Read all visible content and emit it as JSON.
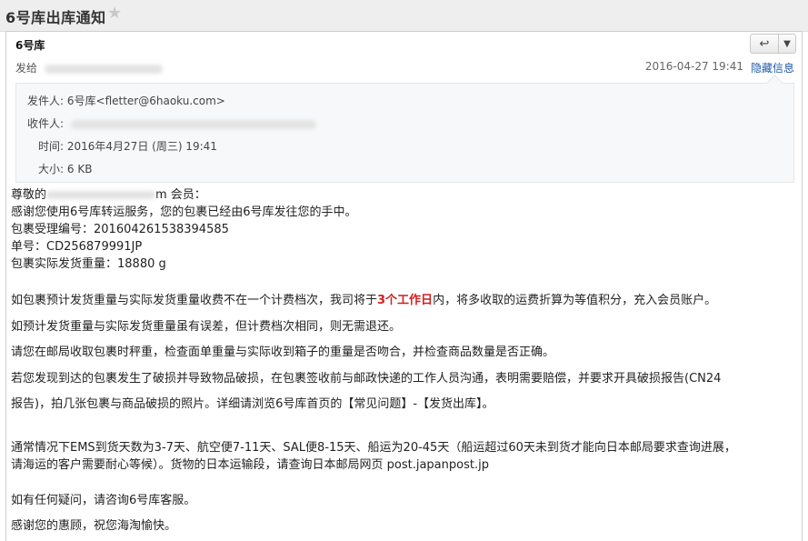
{
  "subject": "6号库出库通知",
  "header": {
    "from_name": "6号库",
    "to_label": "发给",
    "date": "2016-04-27 19:41",
    "hide_details": "隐藏信息"
  },
  "details": {
    "sender_label": "发件人:",
    "sender_value": "6号库<fletter@6haoku.com>",
    "recipient_label": "收件人:",
    "time_label": "时间:",
    "time_value": "2016年4月27日 (周三) 19:41",
    "size_label": "大小:",
    "size_value": "6 KB"
  },
  "body": {
    "greet_prefix": "尊敬的",
    "greet_suffix": "m 会员：",
    "l1": "感谢您使用6号库转运服务，您的包裹已经由6号库发往您的手中。",
    "l2": "包裹受理编号：201604261538394585",
    "l3": "单号：CD256879991JP",
    "l4": "包裹实际发货重量：18880 g",
    "p1_a": "如包裹预计发货重量与实际发货重量收费不在一个计费档次，我司将于",
    "p1_hl": "3个工作日",
    "p1_b": "内，将多收取的运费折算为等值积分，充入会员账户。",
    "p2": "如预计发货重量与实际发货重量虽有误差，但计费档次相同，则无需退还。",
    "p3": "请您在邮局收取包裹时秤重，检查面单重量与实际收到箱子的重量是否吻合，并检查商品数量是否正确。",
    "p4_1": "若您发现到达的包裹发生了破损并导致物品破损，在包裹签收前与邮政快递的工作人员沟通，表明需要赔偿，并要求开具破损报告(CN24",
    "p4_2": "报告)，拍几张包裹与商品破损的照片。详细请浏览6号库首页的【常见问题】-【发货出库】。",
    "p5_1": "通常情况下EMS到货天数为3-7天、航空便7-11天、SAL便8-15天、船运为20-45天（船运超过60天未到货才能向日本邮局要求查询进展，",
    "p5_2": "请海运的客户需要耐心等候）。货物的日本运输段，请查询日本邮局网页 post.japanpost.jp",
    "p6": "如有任何疑问，请咨询6号库客服。",
    "p7": "感谢您的惠顾，祝您海淘愉快。"
  }
}
